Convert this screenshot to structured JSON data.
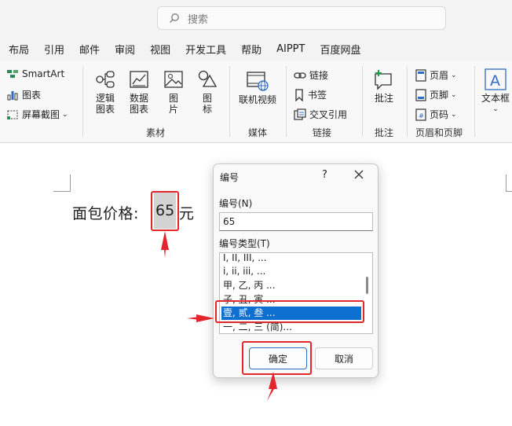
{
  "search": {
    "placeholder": "搜索"
  },
  "menu": {
    "tabs": [
      "布局",
      "引用",
      "邮件",
      "审阅",
      "视图",
      "开发工具",
      "帮助",
      "AIPPT",
      "百度网盘"
    ]
  },
  "ribbon": {
    "illustrations": {
      "smartart": "SmartArt",
      "chart": "图表",
      "screenshot": "屏幕截图"
    },
    "material": {
      "logic": [
        "逻辑",
        "图表"
      ],
      "data": [
        "数据",
        "图表"
      ],
      "picture": [
        "图",
        "片"
      ],
      "icon": [
        "图",
        "标"
      ],
      "label": "素材"
    },
    "media": {
      "online_video": "联机视频",
      "label": "媒体"
    },
    "links": {
      "link": "链接",
      "bookmark": "书签",
      "crossref": "交叉引用",
      "label": "链接"
    },
    "comments": {
      "comment": "批注",
      "label": "批注"
    },
    "header_footer": {
      "header": "页眉",
      "footer": "页脚",
      "page_number": "页码",
      "label": "页眉和页脚"
    },
    "text": {
      "textbox": [
        "文本框"
      ]
    }
  },
  "document": {
    "text_before": "面包价格:",
    "field_value": "65",
    "text_after": "元"
  },
  "dialog": {
    "title": "编号",
    "help": "?",
    "number_label": "编号(N)",
    "number_value": "65",
    "type_label": "编号类型(T)",
    "types": [
      "I, II, III, ...",
      "i, ii, iii, ...",
      "甲, 乙, 丙 ...",
      "子, 丑, 寅 ...",
      "壹, 贰, 叁 ...",
      "一, 二, 三 (简)..."
    ],
    "selected_index": 4,
    "ok": "确定",
    "cancel": "取消"
  },
  "colors": {
    "accent": "#0d6fd0",
    "annotation": "#e3262b"
  }
}
